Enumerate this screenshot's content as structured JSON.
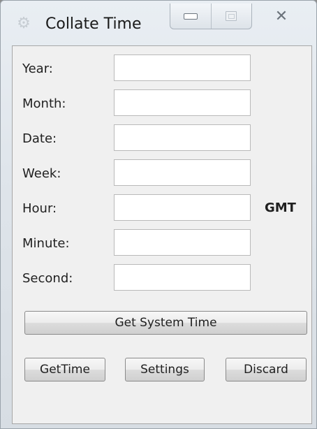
{
  "window": {
    "title": "Collate Time",
    "icon": "gear-icon"
  },
  "fields": [
    {
      "label": "Year:",
      "value": ""
    },
    {
      "label": "Month:",
      "value": ""
    },
    {
      "label": "Date:",
      "value": ""
    },
    {
      "label": "Week:",
      "value": ""
    },
    {
      "label": "Hour:",
      "value": ""
    },
    {
      "label": "Minute:",
      "value": ""
    },
    {
      "label": "Second:",
      "value": ""
    }
  ],
  "hour_suffix": "GMT",
  "buttons": {
    "get_system_time": "Get System Time",
    "get_time": "GetTime",
    "settings": "Settings",
    "discard": "Discard"
  }
}
